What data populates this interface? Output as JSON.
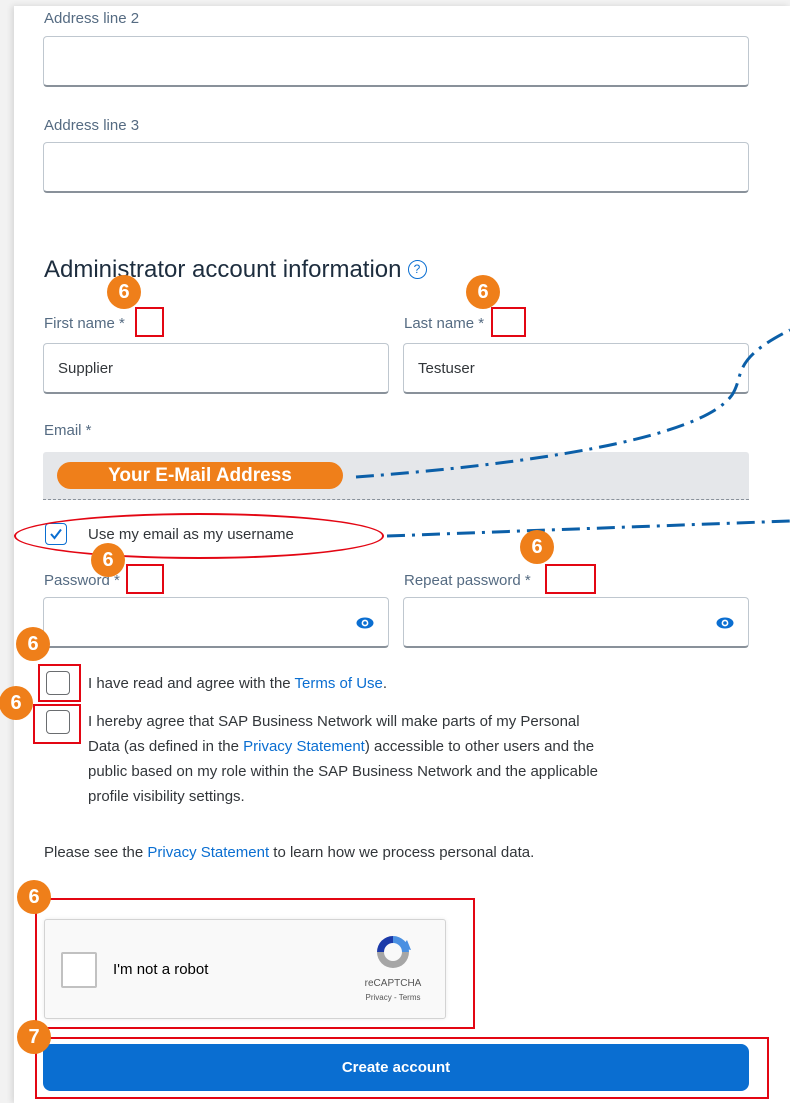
{
  "form": {
    "address_line_2_label": "Address line 2",
    "address_line_2_value": "",
    "address_line_3_label": "Address line 3",
    "address_line_3_value": "",
    "section_title": "Administrator account information",
    "help_glyph": "?",
    "first_name_label": "First name *",
    "first_name_value": "Supplier",
    "last_name_label": "Last name *",
    "last_name_value": "Testuser",
    "email_label": "Email *",
    "email_placeholder": "Your E-Mail Address",
    "use_email_username_label": "Use my email as my username",
    "use_email_username_checked": true,
    "password_label": "Password *",
    "repeat_password_label": "Repeat password *",
    "terms_prefix": "I have read and agree with the ",
    "terms_link": "Terms of Use",
    "terms_suffix": ".",
    "privacy_line1": "I hereby agree that SAP Business Network will make parts of my Personal",
    "privacy_line2_prefix": "Data (as defined in the ",
    "privacy_line2_link": "Privacy Statement",
    "privacy_line2_suffix": ") accessible to other users and the",
    "privacy_line3": "public based on my role within the SAP Business Network and the applicable",
    "privacy_line4": "profile visibility settings.",
    "privacy_note_prefix": "Please see the ",
    "privacy_note_link": "Privacy Statement",
    "privacy_note_suffix": " to learn how we process personal data.",
    "create_button": "Create account"
  },
  "recaptcha": {
    "label": "I'm not a robot",
    "brand": "reCAPTCHA",
    "links": "Privacy - Terms"
  },
  "annotations": {
    "step6": "6",
    "step7": "7"
  },
  "colors": {
    "accent_blue": "#0a6ed1",
    "annotation_orange": "#ef7f1a",
    "annotation_red": "#e30613",
    "connector_blue": "#0b5fa8"
  },
  "icons": [
    "help-icon",
    "eye-icon",
    "checkmark-icon",
    "recaptcha-logo-icon"
  ]
}
